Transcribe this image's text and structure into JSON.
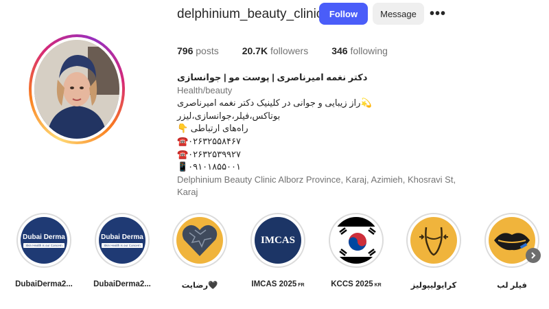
{
  "profile": {
    "username": "delphinium_beauty_clinic",
    "follow_label": "Follow",
    "message_label": "Message",
    "more_label": "•••"
  },
  "stats": {
    "posts_count": "796",
    "posts_label": "posts",
    "followers_count": "20.7K",
    "followers_label": "followers",
    "following_count": "346",
    "following_label": "following"
  },
  "bio": {
    "name": "دکتر نغمه امیرناصری | پوست مو | جوانسازی",
    "category": "Health/beauty",
    "line1": "💫راز زیبایی و جوانی در کلینیک دکتر نغمه امیرناصری",
    "line2": "بوتاکس،فیلر،جوانسازی،لیزر",
    "line3": "راه‌های ارتباطی 👇",
    "line4": "☎️۰۲۶۳۲۵۵۸۴۶۷",
    "line5": "☎️۰۲۶۳۲۵۳۹۹۲۷",
    "line6": "📱۰۹۱۰۱۸۵۵۰۰۱",
    "address": "Delphinium Beauty Clinic Alborz Province, Karaj, Azimieh, Khosravi St, Karaj"
  },
  "stories": [
    {
      "label": "DubaiDerma2...",
      "thumb_text": "Dubai Derma",
      "thumb_sub": "Skin Health is our Concern"
    },
    {
      "label": "DubaiDerma2...",
      "thumb_text": "Dubai Derma",
      "thumb_sub": "Skin Health is our Concern"
    },
    {
      "label": "رضایت🖤"
    },
    {
      "label": "IMCAS 2025",
      "flag": "FR",
      "thumb_text": "IMCAS"
    },
    {
      "label": "KCCS 2025",
      "flag": "KR"
    },
    {
      "label": "کرایولیپولیز"
    },
    {
      "label": "فیلر لب"
    }
  ],
  "icons": {
    "next": "chevron-right-icon"
  },
  "colors": {
    "follow_button": "#4a5df9",
    "message_button": "#efefef",
    "story_navy": "#1f3a74",
    "story_gold": "#f0b43c"
  }
}
